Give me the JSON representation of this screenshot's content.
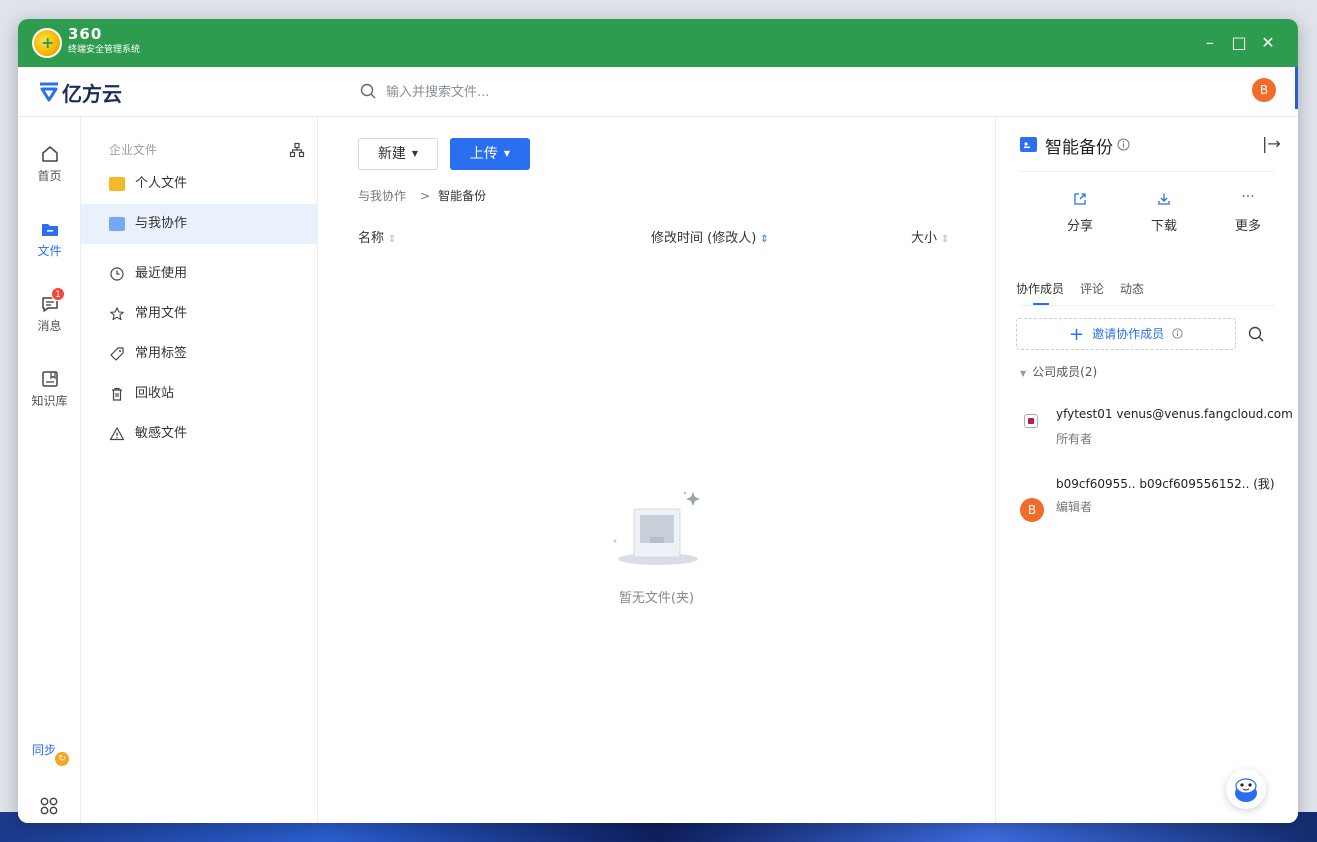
{
  "security_bar": {
    "brand": "360",
    "subtitle": "终端安全管理系统",
    "minimize": "–",
    "maximize": "□",
    "close": "✕"
  },
  "header": {
    "app_name": "亿方云",
    "search_placeholder": "输入并搜索文件...",
    "avatar_letter": "B"
  },
  "rail": {
    "items": [
      {
        "label": "首页",
        "icon": "home-icon"
      },
      {
        "label": "文件",
        "icon": "folder-icon"
      },
      {
        "label": "消息",
        "icon": "message-icon",
        "badge": "1"
      },
      {
        "label": "知识库",
        "icon": "book-icon"
      }
    ],
    "sync_label": "同步",
    "active": "文件"
  },
  "nav": {
    "section": "企业文件",
    "items": [
      {
        "label": "个人文件",
        "icon": "personal-folder-icon"
      },
      {
        "label": "与我协作",
        "icon": "shared-folder-icon"
      },
      {
        "label": "最近使用",
        "icon": "clock-icon"
      },
      {
        "label": "常用文件",
        "icon": "star-icon"
      },
      {
        "label": "常用标签",
        "icon": "tag-icon"
      },
      {
        "label": "回收站",
        "icon": "trash-icon"
      },
      {
        "label": "敏感文件",
        "icon": "warning-icon"
      }
    ],
    "active": "与我协作"
  },
  "main": {
    "new_label": "新建",
    "upload_label": "上传",
    "breadcrumb": [
      "与我协作",
      "智能备份"
    ],
    "columns": {
      "name": "名称",
      "modified": "修改时间 (修改人)",
      "size": "大小"
    },
    "empty_text": "暂无文件(夹)"
  },
  "right_panel": {
    "title": "智能备份",
    "actions": [
      {
        "label": "分享",
        "icon": "share-icon"
      },
      {
        "label": "下载",
        "icon": "download-icon"
      },
      {
        "label": "更多",
        "icon": "more-icon"
      }
    ],
    "tabs": [
      "协作成员",
      "评论",
      "动态"
    ],
    "active_tab": "协作成员",
    "invite_label": "邀请协作成员",
    "group_label": "公司成员(2)",
    "members": [
      {
        "name": "yfytest01 venus@venus.fangcloud.com",
        "role": "所有者"
      },
      {
        "name": "b09cf60955.. b09cf609556152.. (我)",
        "role": "编辑者",
        "avatar_letter": "B"
      }
    ]
  },
  "colors": {
    "accent": "#2a6ff0",
    "security_green": "#2e9c4f",
    "avatar_orange": "#f26b2a"
  }
}
